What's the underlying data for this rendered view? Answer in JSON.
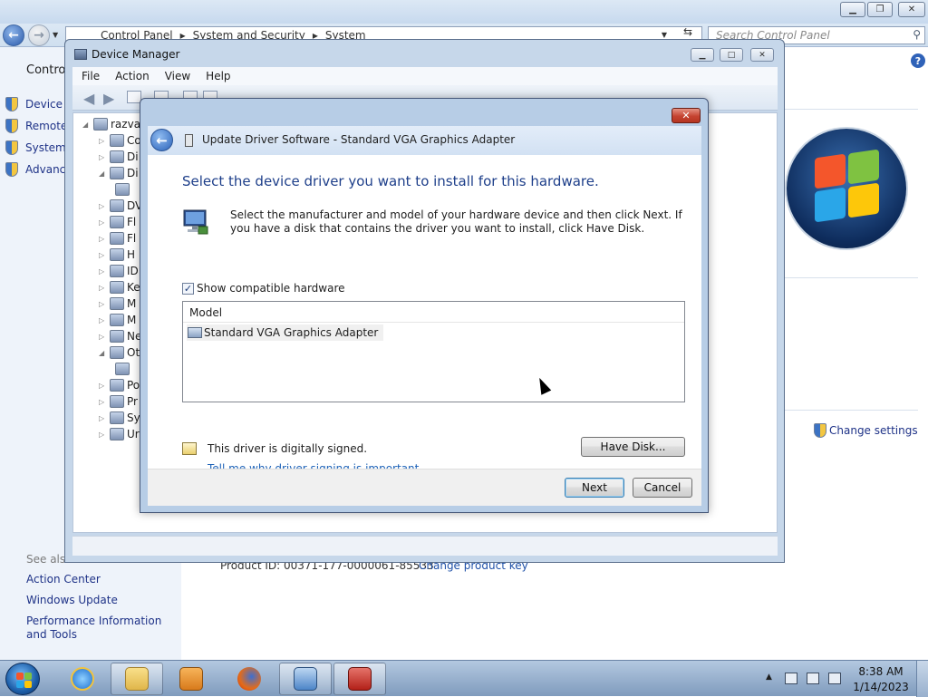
{
  "control_panel": {
    "breadcrumb": [
      "Control Panel",
      "System and Security",
      "System"
    ],
    "search_placeholder": "Search Control Panel",
    "sidebar_title": "Control",
    "sidebar_links": [
      "Device M",
      "Remote",
      "System",
      "Advance"
    ],
    "see_also_label": "See also",
    "see_also_links": [
      "Action Center",
      "Windows Update",
      "Performance Information and Tools"
    ],
    "change_settings": "Change settings",
    "product_id": "Product ID: 00371-177-0000061-85533",
    "change_product_key": "Change product key"
  },
  "device_manager": {
    "title": "Device Manager",
    "menu": [
      "File",
      "Action",
      "View",
      "Help"
    ],
    "tree_root": "razvar",
    "tree_items": [
      "Co",
      "Di",
      "Di",
      "",
      "DV",
      "Fl",
      "Fl",
      "H",
      "ID",
      "Ke",
      "M",
      "M",
      "Ne",
      "Ot",
      "",
      "Po",
      "Pr",
      "Sy",
      "Ur"
    ]
  },
  "update_driver": {
    "title": "Update Driver Software - Standard VGA Graphics Adapter",
    "heading": "Select the device driver you want to install for this hardware.",
    "description": "Select the manufacturer and model of your hardware device and then click Next. If you have a disk that contains the driver you want to install, click Have Disk.",
    "show_compatible_label": "Show compatible hardware",
    "show_compatible_checked": true,
    "check_mark": "✓",
    "list_header": "Model",
    "models": [
      "Standard VGA Graphics Adapter"
    ],
    "signed_text": "This driver is digitally signed.",
    "signing_link": "Tell me why driver signing is important",
    "have_disk": "Have Disk...",
    "next": "Next",
    "cancel": "Cancel",
    "close_glyph": "✕",
    "back_glyph": "←"
  },
  "taskbar": {
    "time": "8:38 AM",
    "date": "1/14/2023"
  }
}
